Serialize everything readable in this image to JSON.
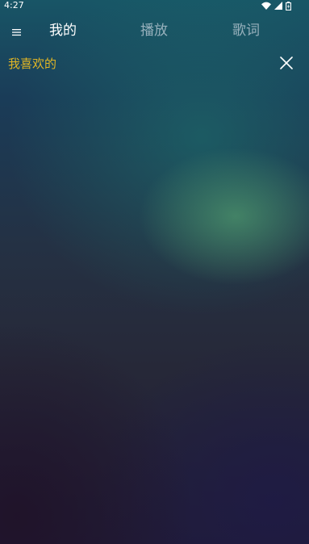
{
  "status_bar": {
    "time": "4:27",
    "icons": [
      "wifi-icon",
      "signal-icon",
      "battery-icon"
    ]
  },
  "top_nav": {
    "menu_icon": "menu-icon",
    "tabs": [
      {
        "label": "我的",
        "active": true
      },
      {
        "label": "播放",
        "active": false
      },
      {
        "label": "歌词",
        "active": false
      }
    ]
  },
  "playlist": {
    "title": "我喜欢的",
    "close_icon": "close-icon"
  },
  "colors": {
    "accent": "#e0b525",
    "tab_active": "#ffffff",
    "tab_inactive": "#c8d4de"
  }
}
